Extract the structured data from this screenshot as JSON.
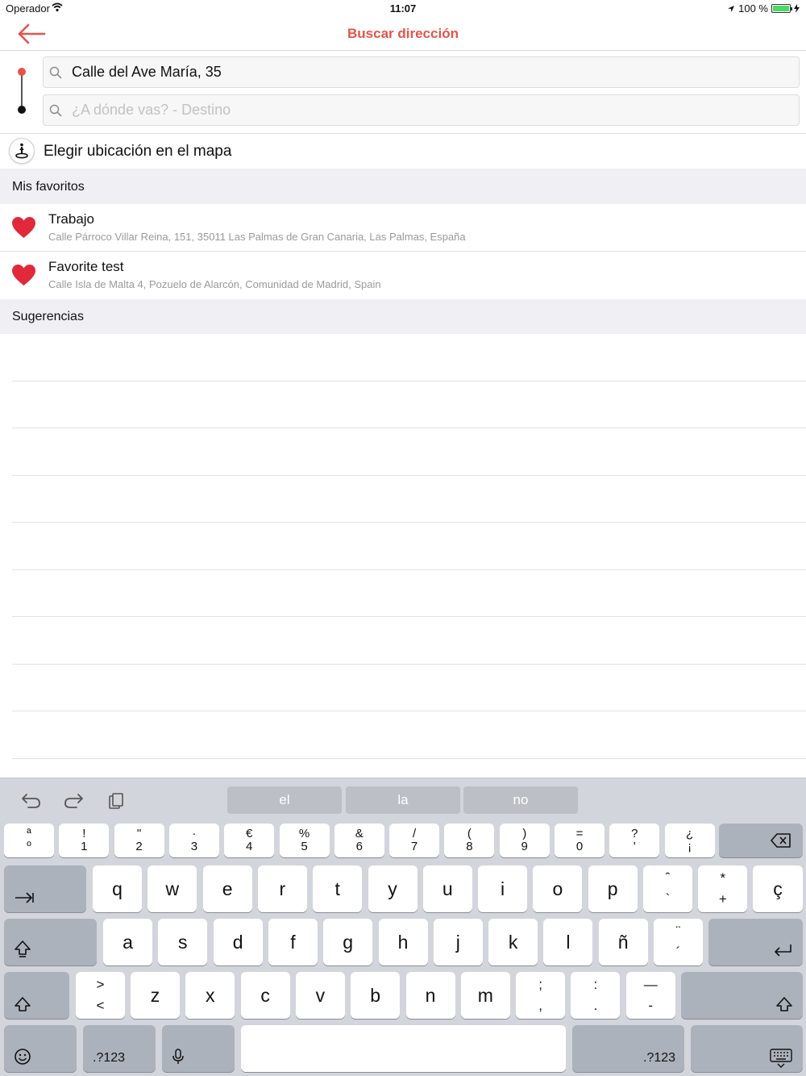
{
  "status_bar": {
    "carrier": "Operador",
    "time": "11:07",
    "battery_text": "100 %",
    "battery_level": 1.0
  },
  "nav": {
    "title": "Buscar dirección"
  },
  "route": {
    "origin_value": "Calle del Ave María, 35",
    "destination_placeholder": "¿A dónde vas? - Destino"
  },
  "map_option": {
    "label": "Elegir ubicación en el mapa"
  },
  "favorites": {
    "header": "Mis favoritos",
    "items": [
      {
        "name": "Trabajo",
        "address": "Calle Párroco Villar Reina, 151, 35011 Las Palmas de Gran Canaria, Las Palmas, España"
      },
      {
        "name": "Favorite test",
        "address": "Calle Isla de Malta 4, Pozuelo de Alarcón, Comunidad de Madrid, Spain"
      }
    ]
  },
  "suggestions": {
    "header": "Sugerencias"
  },
  "keyboard": {
    "predictions": [
      "el",
      "la",
      "no"
    ],
    "num_row": [
      {
        "top": "ª",
        "bottom": "º"
      },
      {
        "top": "!",
        "bottom": "1"
      },
      {
        "top": "\"",
        "bottom": "2"
      },
      {
        "top": "·",
        "bottom": "3"
      },
      {
        "top": "€",
        "bottom": "4"
      },
      {
        "top": "%",
        "bottom": "5"
      },
      {
        "top": "&",
        "bottom": "6"
      },
      {
        "top": "/",
        "bottom": "7"
      },
      {
        "top": "(",
        "bottom": "8"
      },
      {
        "top": ")",
        "bottom": "9"
      },
      {
        "top": "=",
        "bottom": "0"
      },
      {
        "top": "?",
        "bottom": "'"
      },
      {
        "top": "¿",
        "bottom": "¡"
      }
    ],
    "row1": [
      "q",
      "w",
      "e",
      "r",
      "t",
      "y",
      "u",
      "i",
      "o",
      "p"
    ],
    "row1_extra": [
      {
        "top": "ˆ",
        "bottom": "`"
      },
      {
        "top": "*",
        "bottom": "+"
      }
    ],
    "row1_last": "ç",
    "row2": [
      "a",
      "s",
      "d",
      "f",
      "g",
      "h",
      "j",
      "k",
      "l",
      "ñ"
    ],
    "row2_extra": {
      "top": "¨",
      "bottom": "´"
    },
    "row3_first": {
      "top": ">",
      "bottom": "<"
    },
    "row3": [
      "z",
      "x",
      "c",
      "v",
      "b",
      "n",
      "m"
    ],
    "row3_extra": [
      {
        "top": ";",
        "bottom": ","
      },
      {
        "top": ":",
        "bottom": "."
      },
      {
        "top": "—",
        "bottom": "-"
      }
    ],
    "mode_label_left": ".?123",
    "mode_label_right": ".?123"
  },
  "colors": {
    "accent": "#e5534b",
    "heart": "#e0293a",
    "section_bg": "#efeff4",
    "keyboard_bg": "#d2d5db"
  },
  "icons": {
    "back": "arrow-left-icon",
    "search": "search-icon",
    "map": "map-pin-icon",
    "favorite": "heart-icon",
    "undo": "undo-icon",
    "redo": "redo-icon",
    "paste": "paste-icon",
    "backspace": "backspace-icon",
    "tab": "tab-icon",
    "caps": "caps-lock-icon",
    "return": "return-icon",
    "shift": "shift-icon",
    "emoji": "emoji-icon",
    "mic": "microphone-icon",
    "dismiss": "keyboard-dismiss-icon"
  }
}
